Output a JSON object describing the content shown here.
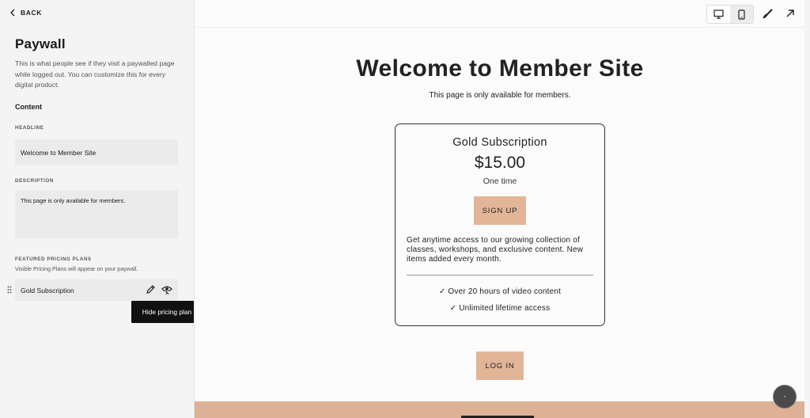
{
  "sidebar": {
    "back_label": "BACK",
    "title": "Paywall",
    "description": "This is what people see if they visit a paywalled page while logged out. You can customize this for every digital product.",
    "section_heading": "Content",
    "headline_label": "HEADLINE",
    "headline_value": "Welcome to Member Site",
    "description_label": "DESCRIPTION",
    "description_value": "This page is only available for members.",
    "featured_label": "FEATURED PRICING PLANS",
    "featured_note": "Visible Pricing Plans will appear on your paywall.",
    "plan_name": "Gold Subscription",
    "tooltip": "Hide pricing plan"
  },
  "toolbar": {
    "icons": [
      "desktop-icon",
      "mobile-icon",
      "brush-icon",
      "open-external-icon"
    ],
    "active_device": "mobile"
  },
  "site": {
    "title": "Welcome to Member Site",
    "subtitle": "This page is only available for members.",
    "plan": {
      "name": "Gold Subscription",
      "price": "$15.00",
      "term": "One time",
      "cta": "SIGN UP",
      "description": "Get anytime access to our growing collection of classes, workshops, and exclusive content. New items added every month.",
      "features": [
        "✓ Over 20 hours of video content",
        "✓ Unlimited lifetime access"
      ]
    },
    "login_label": "LOG IN"
  },
  "colors": {
    "accent": "#e2b598",
    "footer": "#dcb196",
    "tooltip_bg": "#111111"
  }
}
